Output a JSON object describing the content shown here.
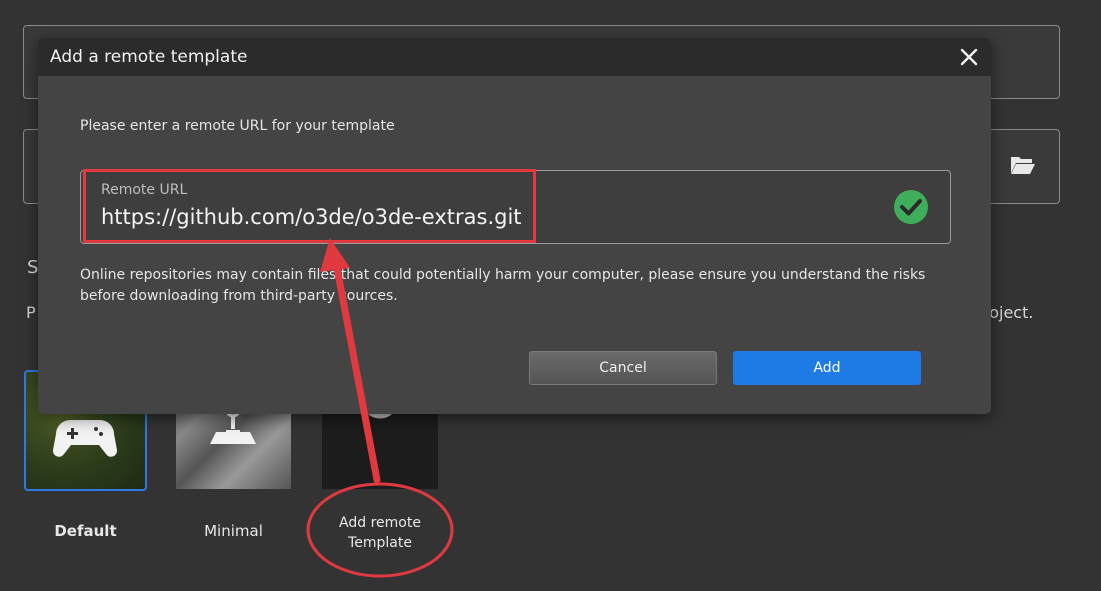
{
  "background": {
    "section_heading": "S",
    "description_left": "P",
    "description_right": "roject."
  },
  "templates": [
    {
      "label": "Default",
      "selected": true,
      "icon": "gamepad-icon"
    },
    {
      "label": "Minimal",
      "selected": false,
      "icon": "joystick-icon"
    },
    {
      "label": "Add remote\nTemplate",
      "selected": false,
      "icon": "o3de-ring-icon"
    }
  ],
  "dialog": {
    "title": "Add a remote template",
    "prompt": "Please enter a remote URL for your template",
    "url_field": {
      "label": "Remote URL",
      "value": "https://github.com/o3de/o3de-extras.git",
      "valid": true
    },
    "warning": "Online repositories may contain files that could potentially harm your computer, please ensure you understand the risks before downloading from third-party sources.",
    "cancel_label": "Cancel",
    "add_label": "Add"
  },
  "colors": {
    "accent": "#1e7be6",
    "annotation": "#e03a40",
    "valid_check": "#3fae5a"
  }
}
